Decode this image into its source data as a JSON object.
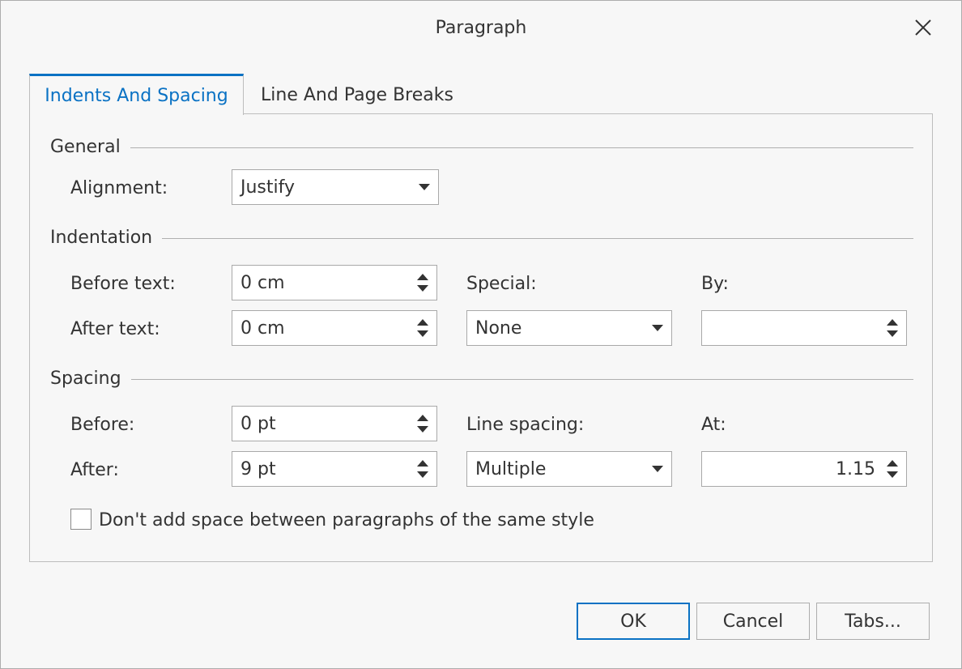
{
  "dialog": {
    "title": "Paragraph"
  },
  "tabs": [
    {
      "label": "Indents And Spacing",
      "active": true
    },
    {
      "label": "Line And Page Breaks",
      "active": false
    }
  ],
  "general": {
    "header": "General",
    "alignment_label": "Alignment:",
    "alignment_value": "Justify"
  },
  "indentation": {
    "header": "Indentation",
    "before_text_label": "Before text:",
    "before_text_value": "0 cm",
    "after_text_label": "After text:",
    "after_text_value": "0 cm",
    "special_label": "Special:",
    "special_value": "None",
    "by_label": "By:",
    "by_value": ""
  },
  "spacing": {
    "header": "Spacing",
    "before_label": "Before:",
    "before_value": "0 pt",
    "after_label": "After:",
    "after_value": "9 pt",
    "line_spacing_label": "Line spacing:",
    "line_spacing_value": "Multiple",
    "at_label": "At:",
    "at_value": "1.15"
  },
  "options": {
    "dont_add_space_label": "Don't add space between paragraphs of the same style",
    "dont_add_space_checked": false
  },
  "buttons": {
    "ok": "OK",
    "cancel": "Cancel",
    "tabs": "Tabs..."
  },
  "colors": {
    "accent": "#0a72c4",
    "text": "#333333",
    "background": "#f7f7f7",
    "border": "#adadad"
  },
  "icons": {
    "close": "close-icon",
    "dropdown": "chevron-down-icon",
    "spin_up": "spin-up-icon",
    "spin_down": "spin-down-icon"
  }
}
